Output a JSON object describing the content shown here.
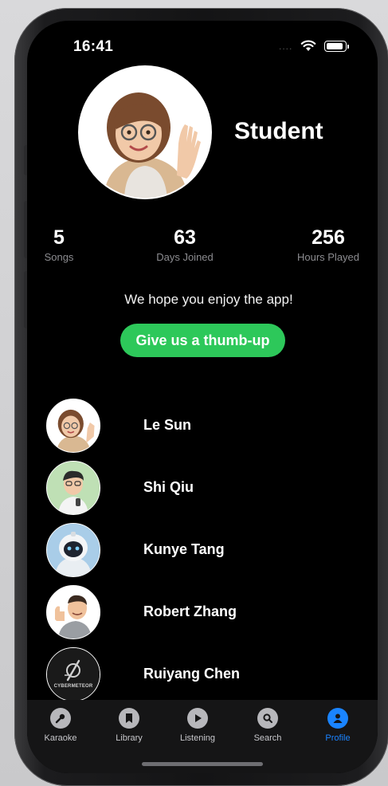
{
  "status": {
    "time": "16:41",
    "signal": "....",
    "wifi_icon": "wifi-icon",
    "battery_icon": "battery-icon"
  },
  "profile": {
    "name": "Student",
    "avatar_icon": "memoji-girl-waving",
    "stats": [
      {
        "value": "5",
        "label": "Songs"
      },
      {
        "value": "63",
        "label": "Days Joined"
      },
      {
        "value": "256",
        "label": "Hours Played"
      }
    ],
    "message": "We hope you enjoy the app!",
    "thumb_button": "Give us a thumb-up"
  },
  "members": [
    {
      "name": "Le Sun",
      "avatar": "memoji-girl-waving"
    },
    {
      "name": "Shi Qiu",
      "avatar": "memoji-boy-glasses"
    },
    {
      "name": "Kunye Tang",
      "avatar": "robot-avatar"
    },
    {
      "name": "Robert Zhang",
      "avatar": "memoji-boy-thumbs-up"
    },
    {
      "name": "Ruiyang Chen",
      "avatar": "cybermeteor-logo",
      "logo_text": "CYBERMETEOR"
    }
  ],
  "tabs": [
    {
      "label": "Karaoke",
      "icon": "microphone-icon"
    },
    {
      "label": "Library",
      "icon": "bookmark-icon"
    },
    {
      "label": "Listening",
      "icon": "play-icon"
    },
    {
      "label": "Search",
      "icon": "search-icon"
    },
    {
      "label": "Profile",
      "icon": "person-icon",
      "active": true
    }
  ],
  "colors": {
    "accent": "#1a84ff",
    "button_green": "#2dc85a",
    "background": "#000000"
  }
}
